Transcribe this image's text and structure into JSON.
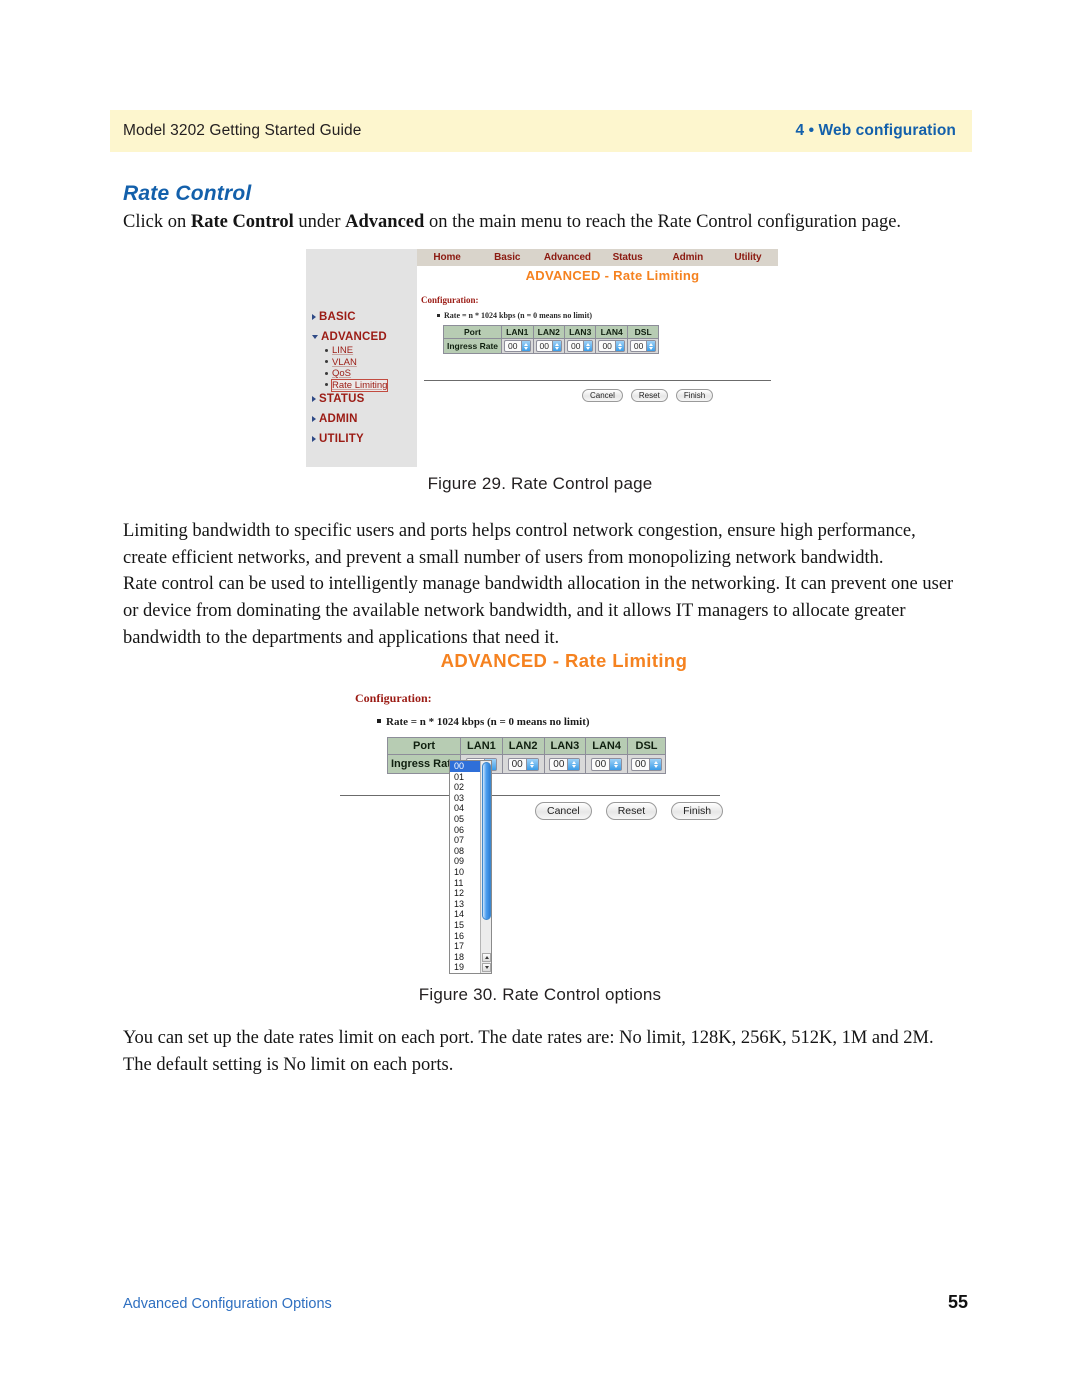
{
  "header": {
    "left": "Model 3202 Getting Started Guide",
    "right": "4 • Web configuration",
    "band_color": "#fdf6ce",
    "accent_color": "#1360ab"
  },
  "section": {
    "title": "Rate Control",
    "intro_prefix": "Click on ",
    "intro_bold1": "Rate Control",
    "intro_mid": " under ",
    "intro_bold2": "Advanced",
    "intro_suffix": " on the main menu to reach the Rate Control configuration page."
  },
  "figure1": {
    "caption": "Figure 29. Rate Control page",
    "navbar": [
      "Home",
      "Basic",
      "Advanced",
      "Status",
      "Admin",
      "Utility"
    ],
    "page_title": "ADVANCED - Rate Limiting",
    "config_label": "Configuration:",
    "note": "Rate = n * 1024 kbps (n = 0 means no limit)",
    "sidebar": {
      "basic": "BASIC",
      "advanced": "ADVANCED",
      "sub_items": [
        "LINE",
        "VLAN",
        "QoS",
        "Rate Limiting"
      ],
      "selected_sub": "Rate Limiting",
      "status": "STATUS",
      "admin": "ADMIN",
      "utility": "UTILITY"
    },
    "table": {
      "headers": [
        "Port",
        "LAN1",
        "LAN2",
        "LAN3",
        "LAN4",
        "DSL"
      ],
      "row_label": "Ingress Rate",
      "values": [
        "00",
        "00",
        "00",
        "00",
        "00"
      ]
    },
    "buttons": [
      "Cancel",
      "Reset",
      "Finish"
    ]
  },
  "figure2": {
    "caption": "Figure 30. Rate Control options",
    "page_title": "ADVANCED - Rate Limiting",
    "config_label": "Configuration:",
    "note": "Rate = n * 1024 kbps (n = 0 means no limit)",
    "table": {
      "headers": [
        "Port",
        "LAN1",
        "LAN2",
        "LAN3",
        "LAN4",
        "DSL"
      ],
      "row_label": "Ingress Rate",
      "values": [
        "00",
        "00",
        "00",
        "00",
        "00"
      ]
    },
    "dropdown": {
      "selected": "00",
      "options": [
        "00",
        "01",
        "02",
        "03",
        "04",
        "05",
        "06",
        "07",
        "08",
        "09",
        "10",
        "11",
        "12",
        "13",
        "14",
        "15",
        "16",
        "17",
        "18",
        "19"
      ],
      "highlight_color": "#2f6fd8"
    },
    "buttons": [
      "Cancel",
      "Reset",
      "Finish"
    ]
  },
  "body": {
    "para1": "Limiting bandwidth to specific users and ports helps control network congestion, ensure high performance, create efficient networks, and prevent a small number of users from monopolizing network bandwidth.",
    "para2": "Rate control can be used to intelligently manage bandwidth allocation in the networking. It can prevent one user or device from dominating the available network bandwidth, and it allows IT managers to allocate greater bandwidth to the departments and applications that need it.",
    "para3": "You can set up the date rates limit on each port. The date rates are:  No limit, 128K, 256K, 512K, 1M and 2M. The default setting is No limit on each ports."
  },
  "footer": {
    "left": "Advanced Configuration Options",
    "page_number": "55"
  }
}
